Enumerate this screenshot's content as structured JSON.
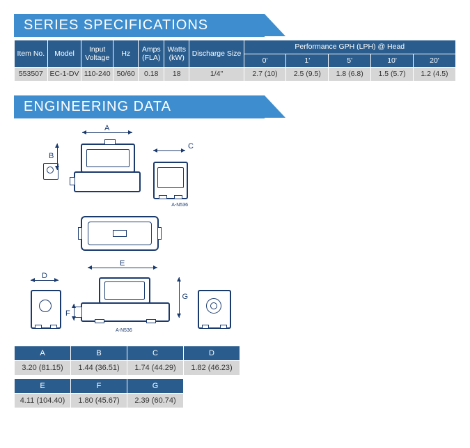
{
  "series_spec_title": "SERIES SPECIFICATIONS",
  "spec_headers": {
    "item_no": "Item No.",
    "model": "Model",
    "input_voltage": "Input Voltage",
    "hz": "Hz",
    "amps": "Amps (FLA)",
    "watts": "Watts (kW)",
    "discharge": "Discharge Size",
    "perf_title": "Performance GPH (LPH) @ Head",
    "h0": "0'",
    "h1": "1'",
    "h5": "5'",
    "h10": "10'",
    "h20": "20'"
  },
  "spec_row": {
    "item_no": "553507",
    "model": "EC-1-DV",
    "input_voltage": "110-240",
    "hz": "50/60",
    "amps": "0.18",
    "watts": "18",
    "discharge": "1/4\"",
    "h0": "2.7 (10)",
    "h1": "2.5 (9.5)",
    "h5": "1.8 (6.8)",
    "h10": "1.5 (5.7)",
    "h20": "1.2 (4.5)"
  },
  "eng_data_title": "ENGINEERING DATA",
  "dim_labels": {
    "A": "A",
    "B": "B",
    "C": "C",
    "D": "D",
    "E": "E",
    "F": "F",
    "G": "G"
  },
  "drawing_ref": "A-N536",
  "dims1_headers": [
    "A",
    "B",
    "C",
    "D"
  ],
  "dims1_values": [
    "3.20 (81.15)",
    "1.44 (36.51)",
    "1.74 (44.29)",
    "1.82 (46.23)"
  ],
  "dims2_headers": [
    "E",
    "F",
    "G"
  ],
  "dims2_values": [
    "4.11 (104.40)",
    "1.80 (45.67)",
    "2.39 (60.74)"
  ],
  "chart_data": {
    "type": "table",
    "title": "Series Specifications",
    "columns": [
      "Item No.",
      "Model",
      "Input Voltage",
      "Hz",
      "Amps (FLA)",
      "Watts (kW)",
      "Discharge Size",
      "0'",
      "1'",
      "5'",
      "10'",
      "20'"
    ],
    "rows": [
      [
        "553507",
        "EC-1-DV",
        "110-240",
        "50/60",
        "0.18",
        "18",
        "1/4\"",
        "2.7 (10)",
        "2.5 (9.5)",
        "1.8 (6.8)",
        "1.5 (5.7)",
        "1.2 (4.5)"
      ]
    ],
    "dimensions_mm_in": {
      "A": "3.20 (81.15)",
      "B": "1.44 (36.51)",
      "C": "1.74 (44.29)",
      "D": "1.82 (46.23)",
      "E": "4.11 (104.40)",
      "F": "1.80 (45.67)",
      "G": "2.39 (60.74)"
    }
  }
}
